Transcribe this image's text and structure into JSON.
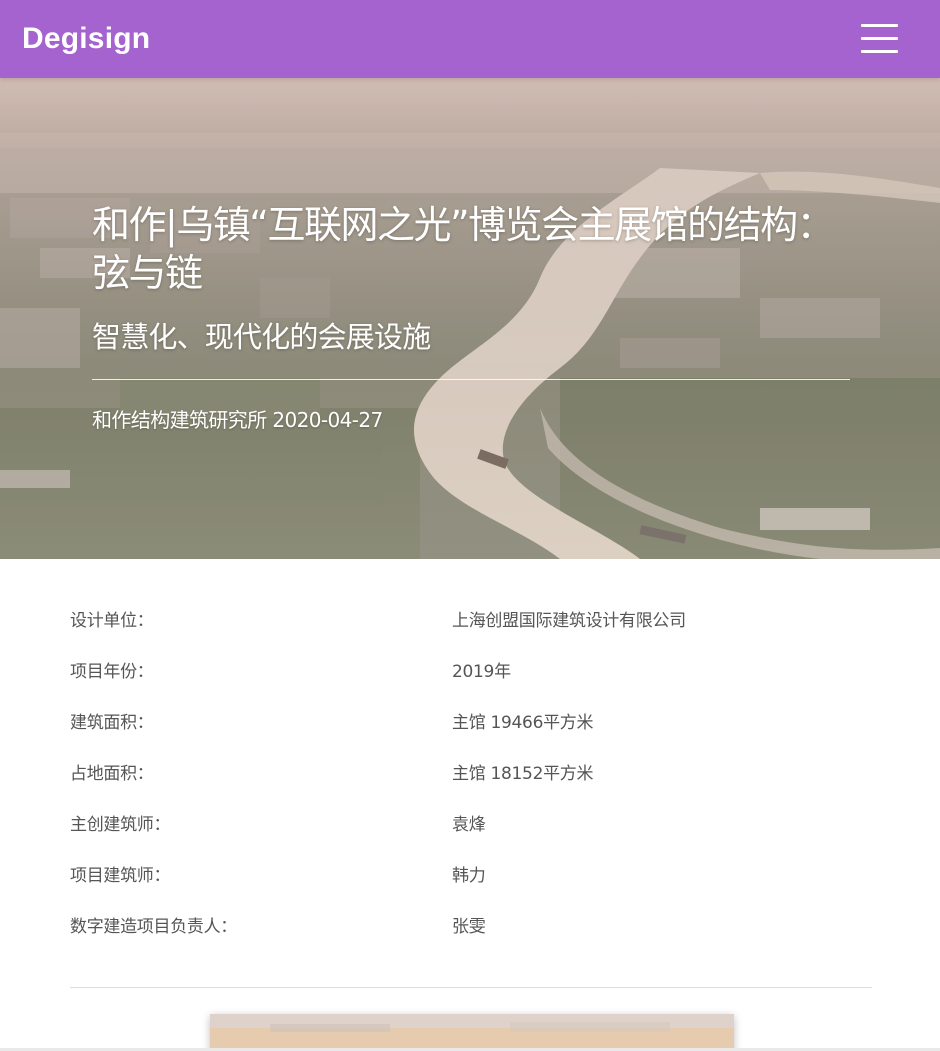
{
  "navbar": {
    "brand": "Degisign",
    "menu_icon": "hamburger-menu-icon",
    "background": "#a463cf"
  },
  "hero": {
    "image": "aerial-river-town-photo",
    "title": "和作|乌镇“互联网之光”博览会主展馆的结构：弦与链",
    "subtitle": "智慧化、现代化的会展设施",
    "author": "和作结构建筑研究所",
    "date": "2020-04-27"
  },
  "project_info": [
    {
      "label": "设计单位：",
      "value": "上海创盟国际建筑设计有限公司"
    },
    {
      "label": "项目年份：",
      "value": "2019年"
    },
    {
      "label": "建筑面积：",
      "value": "主馆 19466平方米"
    },
    {
      "label": "占地面积：",
      "value": "主馆 18152平方米"
    },
    {
      "label": "主创建筑师：",
      "value": "袁烽"
    },
    {
      "label": "项目建筑师：",
      "value": "韩力"
    },
    {
      "label": "数字建造项目负责人：",
      "value": "张雯"
    }
  ],
  "content_image": "article-thumbnail-photo"
}
